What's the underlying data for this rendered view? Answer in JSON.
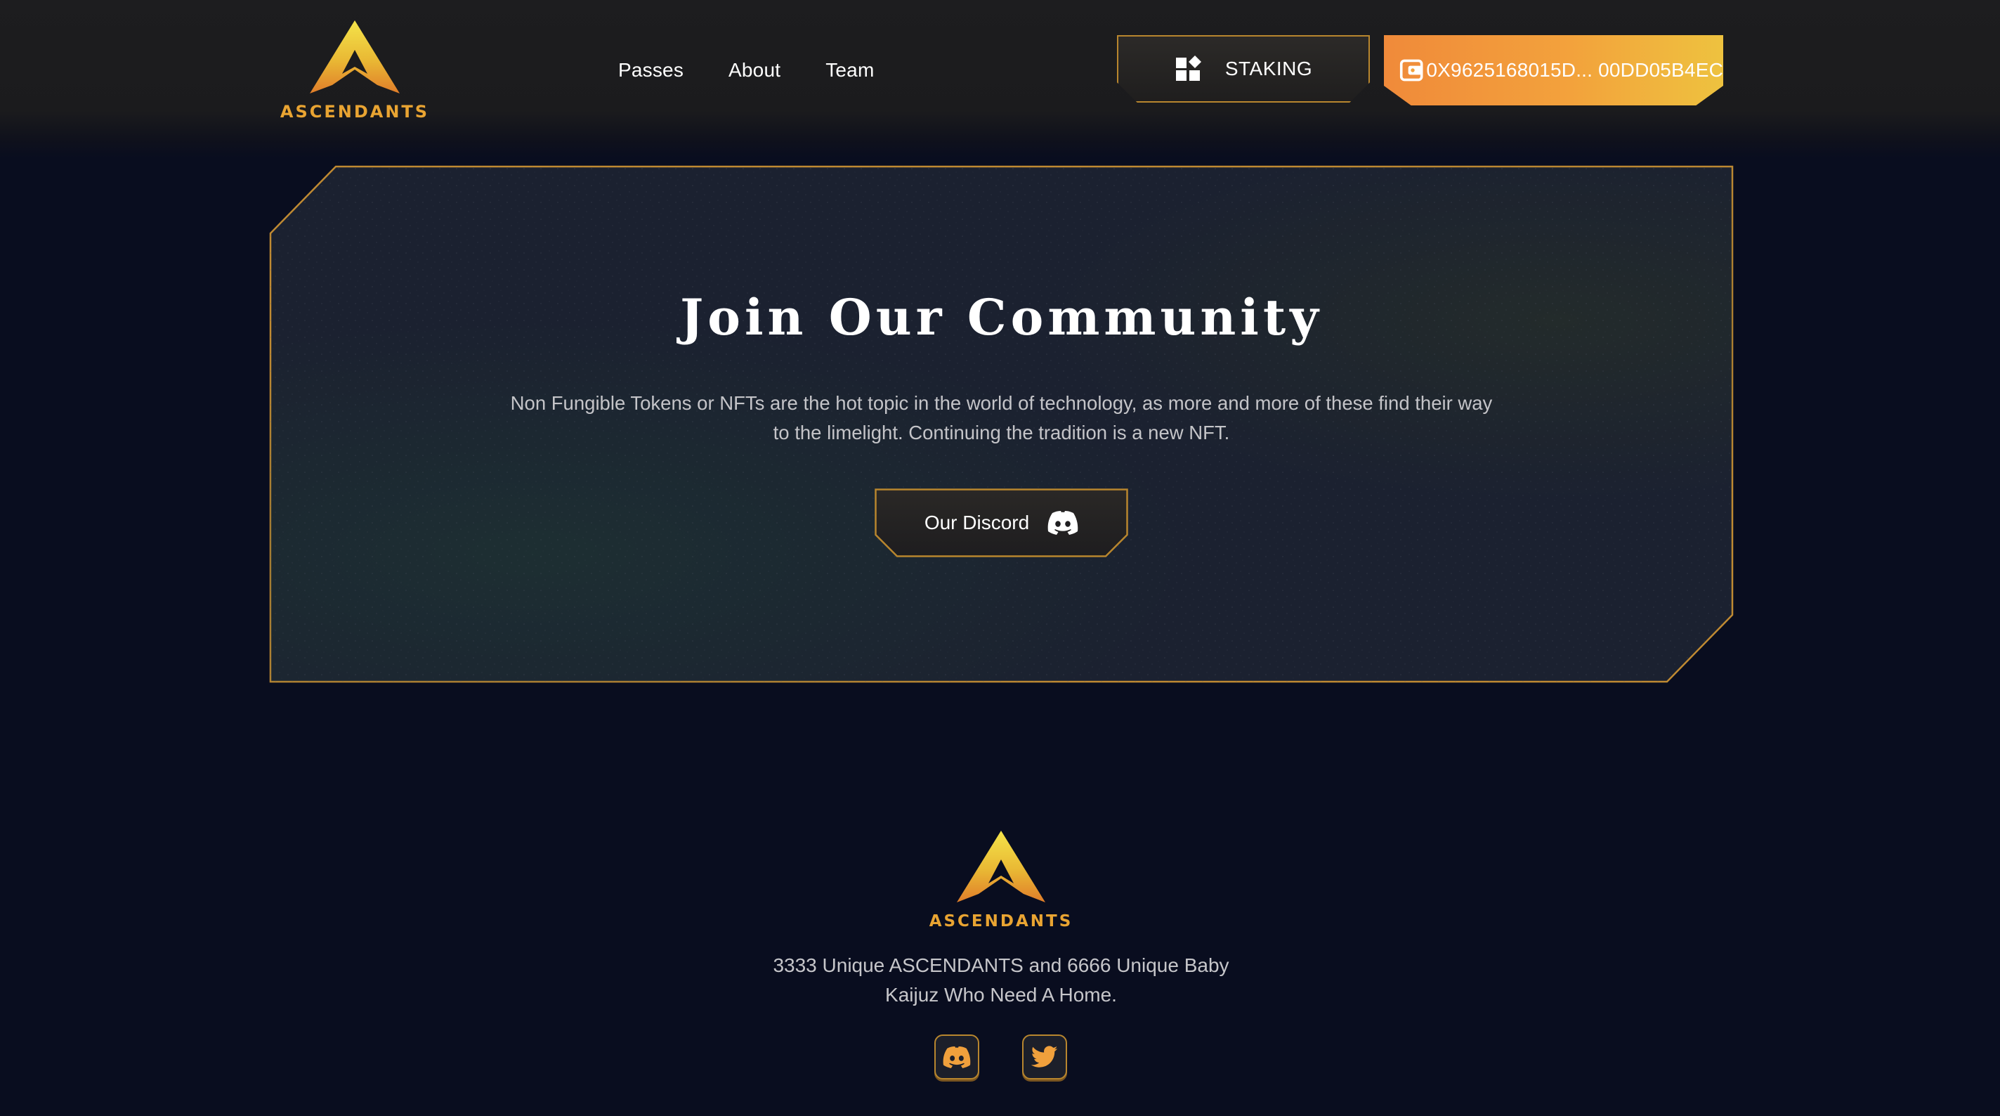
{
  "brand": {
    "name": "ASCENDANTS",
    "accent_color": "#f3a23c",
    "gold_color": "#e8c83a",
    "border_color": "#b8862e",
    "background_color": "#090d1f"
  },
  "header": {
    "nav": [
      {
        "label": "Passes"
      },
      {
        "label": "About"
      },
      {
        "label": "Team"
      }
    ],
    "staking_button": {
      "label": "STAKING",
      "icon": "widgets-icon"
    },
    "wallet_button": {
      "label": "0X9625168015D... 00DD05B4EC",
      "icon": "wallet-icon"
    }
  },
  "community": {
    "title": "Join Our Community",
    "text": "Non Fungible Tokens or NFTs are the hot topic in the world of technology, as more and more of these find their way to the limelight. Continuing the tradition is a new NFT.",
    "discord_button": {
      "label": "Our Discord",
      "icon": "discord-icon"
    }
  },
  "footer": {
    "text": "3333 Unique ASCENDANTS and 6666 Unique Baby Kaijuz Who Need A Home.",
    "social": [
      {
        "name": "discord",
        "icon": "discord-icon"
      },
      {
        "name": "twitter",
        "icon": "twitter-icon"
      }
    ]
  }
}
